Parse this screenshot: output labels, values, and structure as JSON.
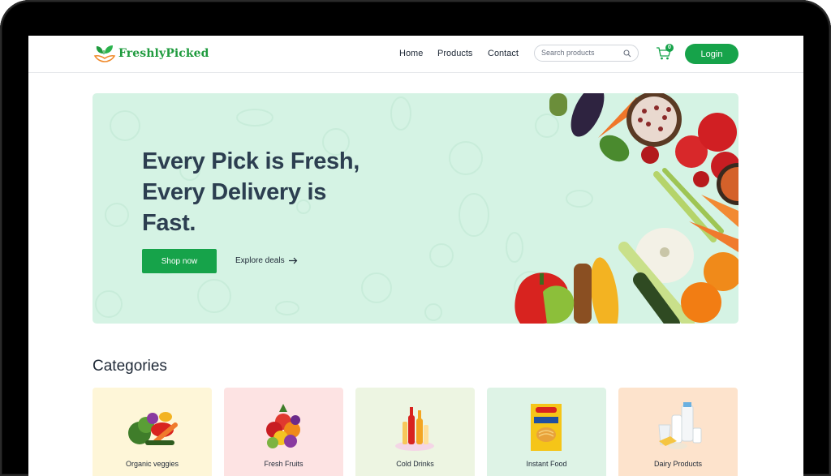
{
  "brand": {
    "name": "FreshlyPicked",
    "color": "#1f9b3e"
  },
  "nav": {
    "links": [
      {
        "label": "Home"
      },
      {
        "label": "Products"
      },
      {
        "label": "Contact"
      }
    ],
    "search": {
      "placeholder": "Search products",
      "value": "",
      "icon": "search-icon"
    },
    "cart": {
      "count": "0",
      "icon": "cart-icon"
    },
    "login_label": "Login"
  },
  "hero": {
    "title": "Every Pick is Fresh, Every Delivery is Fast.",
    "cta_primary": "Shop now",
    "cta_secondary": "Explore deals",
    "background": "#d5f3e4",
    "accent": "#16a34a"
  },
  "categories": {
    "title": "Categories",
    "items": [
      {
        "label": "Organic veggies",
        "background": "#fef6d8",
        "icon": "vegetables-icon"
      },
      {
        "label": "Fresh Fruits",
        "background": "#fde3e3",
        "icon": "fruits-icon"
      },
      {
        "label": "Cold Drinks",
        "background": "#edf5e2",
        "icon": "drinks-icon"
      },
      {
        "label": "Instant Food",
        "background": "#def3e6",
        "icon": "noodles-icon"
      },
      {
        "label": "Dairy Products",
        "background": "#fde3cc",
        "icon": "dairy-icon"
      }
    ]
  }
}
